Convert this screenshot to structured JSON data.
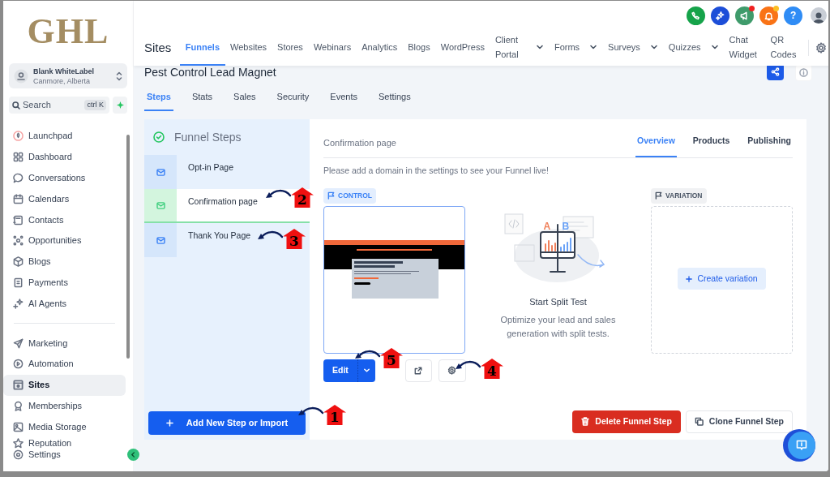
{
  "sidebar": {
    "logo": "GHL",
    "account": {
      "name": "Blank WhiteLabel",
      "location": "Canmore, Alberta"
    },
    "search": {
      "placeholder": "Search",
      "shortcut": "ctrl K"
    },
    "groups": [
      [
        {
          "label": "Launchpad",
          "selected": false
        },
        {
          "label": "Dashboard",
          "selected": false
        },
        {
          "label": "Conversations",
          "selected": false
        },
        {
          "label": "Calendars",
          "selected": false
        },
        {
          "label": "Contacts",
          "selected": false
        },
        {
          "label": "Opportunities",
          "selected": false
        },
        {
          "label": "Blogs",
          "selected": false
        },
        {
          "label": "Payments",
          "selected": false
        },
        {
          "label": "AI Agents",
          "selected": false
        }
      ],
      [
        {
          "label": "Marketing",
          "selected": false
        },
        {
          "label": "Automation",
          "selected": false
        },
        {
          "label": "Sites",
          "selected": true
        },
        {
          "label": "Memberships",
          "selected": false
        },
        {
          "label": "Media Storage",
          "selected": false
        },
        {
          "label": "Reputation",
          "selected": false
        }
      ]
    ],
    "footer_item": {
      "label": "Settings"
    }
  },
  "header": {
    "actions": [
      {
        "color": "#16a34a"
      },
      {
        "color": "#1d4ed8"
      },
      {
        "color": "#3f9b6b",
        "dot": {
          "color": "#ef2020"
        }
      },
      {
        "color": "#f97316",
        "dot": {
          "color": "#fbbf24"
        }
      },
      {
        "color": "#2f8cf5",
        "label": "?"
      }
    ],
    "section": "Sites",
    "tabs": [
      {
        "label": "Funnels",
        "selected": true,
        "dropdown": false,
        "wrapped": false
      },
      {
        "label": "Websites",
        "selected": false,
        "dropdown": false,
        "wrapped": false
      },
      {
        "label": "Stores",
        "selected": false,
        "dropdown": false,
        "wrapped": false
      },
      {
        "label": "Webinars",
        "selected": false,
        "dropdown": false,
        "wrapped": false
      },
      {
        "label": "Analytics",
        "selected": false,
        "dropdown": false,
        "wrapped": false
      },
      {
        "label": "Blogs",
        "selected": false,
        "dropdown": false,
        "wrapped": false
      },
      {
        "label": "WordPress",
        "selected": false,
        "dropdown": false,
        "wrapped": false
      },
      {
        "label": "Client Portal",
        "selected": false,
        "dropdown": true,
        "wrapped": true
      },
      {
        "label": "Forms",
        "selected": false,
        "dropdown": true,
        "wrapped": false
      },
      {
        "label": "Surveys",
        "selected": false,
        "dropdown": true,
        "wrapped": false
      },
      {
        "label": "Quizzes",
        "selected": false,
        "dropdown": true,
        "wrapped": false
      },
      {
        "label": "Chat Widget",
        "selected": false,
        "dropdown": false,
        "wrapped": true
      },
      {
        "label": "QR Codes",
        "selected": false,
        "dropdown": false,
        "wrapped": true
      }
    ]
  },
  "funnel": {
    "title": "Pest Control Lead Magnet",
    "tabs": [
      {
        "label": "Steps",
        "selected": true
      },
      {
        "label": "Stats",
        "selected": false
      },
      {
        "label": "Sales",
        "selected": false
      },
      {
        "label": "Security",
        "selected": false
      },
      {
        "label": "Events",
        "selected": false
      },
      {
        "label": "Settings",
        "selected": false
      }
    ],
    "steps_panel": {
      "title": "Funnel Steps",
      "steps": [
        {
          "label": "Opt-in Page",
          "selected": false
        },
        {
          "label": "Confirmation page",
          "selected": true
        },
        {
          "label": "Thank You Page",
          "selected": false
        }
      ],
      "add_button": "Add New Step or Import"
    },
    "step_detail": {
      "title": "Confirmation page",
      "tabs": [
        {
          "label": "Overview",
          "selected": true
        },
        {
          "label": "Products",
          "selected": false
        },
        {
          "label": "Publishing",
          "selected": false
        }
      ],
      "notice": "Please add a domain in the settings to see your Funnel live!",
      "control_label": "CONTROL",
      "edit_button": "Edit",
      "split_test": {
        "title": "Start Split Test",
        "description": "Optimize your lead and sales generation with split tests.",
        "a": "A",
        "b": "B"
      },
      "variation_label": "VARIATION",
      "create_variation": "Create variation",
      "delete_button": "Delete Funnel Step",
      "clone_button": "Clone Funnel Step"
    }
  },
  "annotations": [
    {
      "number": "1"
    },
    {
      "number": "2"
    },
    {
      "number": "3"
    },
    {
      "number": "4"
    },
    {
      "number": "5"
    }
  ]
}
